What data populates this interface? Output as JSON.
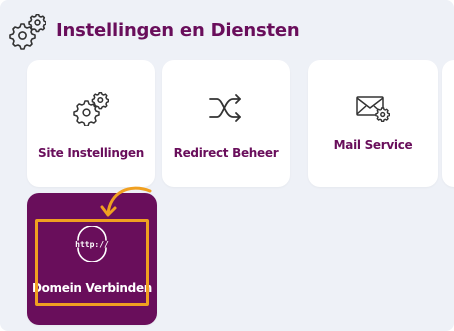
{
  "header": {
    "title": "Instellingen en Diensten",
    "icon": "gears-icon"
  },
  "cards": [
    {
      "label": "Site Instellingen",
      "icon": "gears-icon"
    },
    {
      "label": "Redirect Beheer",
      "icon": "shuffle-icon"
    },
    {
      "label": "Mail Service",
      "icon": "mail-gear-icon"
    },
    {
      "label": "Domein Verbinden",
      "icon": "http-globe-icon",
      "badge": "http://",
      "active": true
    }
  ],
  "colors": {
    "brand": "#690e5b",
    "panel_bg": "#eef1f7",
    "highlight": "#f0a020",
    "icon_stroke": "#333333"
  }
}
